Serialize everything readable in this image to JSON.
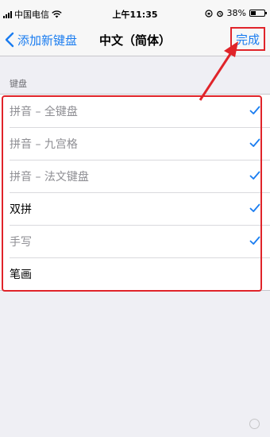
{
  "status_bar": {
    "carrier": "中国电信",
    "time": "上午11:35",
    "battery": "38%",
    "battery_level": 0.38,
    "icons": [
      "signal-icon",
      "wifi-icon",
      "orientation-lock-icon",
      "alarm-icon",
      "battery-icon"
    ]
  },
  "nav": {
    "back_label": "添加新键盘",
    "title": "中文（简体）",
    "done_label": "完成"
  },
  "section": {
    "header": "键盘"
  },
  "keyboards": [
    {
      "label": "拼音 – 全键盘",
      "checked": true,
      "enabled": false
    },
    {
      "label": "拼音 – 九宫格",
      "checked": true,
      "enabled": false
    },
    {
      "label": "拼音 – 法文键盘",
      "checked": true,
      "enabled": false
    },
    {
      "label": "双拼",
      "checked": true,
      "enabled": true
    },
    {
      "label": "手写",
      "checked": true,
      "enabled": false
    },
    {
      "label": "笔画",
      "checked": false,
      "enabled": true
    }
  ],
  "watermark": "",
  "colors": {
    "accent": "#1a7cf0",
    "annotation_red": "#e0242a",
    "background": "#efeff4"
  }
}
